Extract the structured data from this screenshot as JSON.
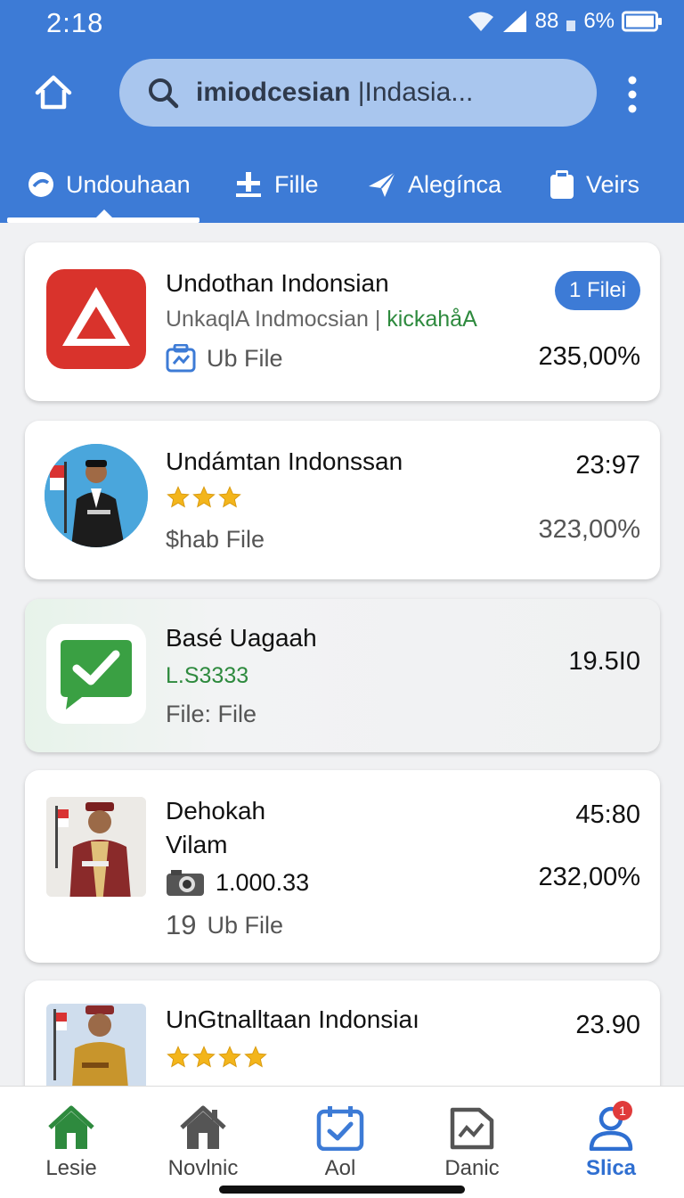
{
  "status_bar": {
    "time": "2:18",
    "network": "88",
    "battery": "6%"
  },
  "search": {
    "query_bold": "imiodcesian",
    "query_rest": " |Indasia..."
  },
  "tabs": [
    {
      "label": "Undouhaan",
      "icon": "download-icon",
      "active": true
    },
    {
      "label": "Fille",
      "icon": "file-icon"
    },
    {
      "label": "Alegínca",
      "icon": "send-icon"
    },
    {
      "label": "Veirs",
      "icon": "folder-icon"
    }
  ],
  "items": [
    {
      "title": "Undothan Indonsian",
      "subtitle_gray": "UnkaqlA Indmocsian |",
      "subtitle_green": " kickahåA",
      "meta_icon": "sync-icon",
      "meta": "Ub File",
      "badge": "1 Filei",
      "right": "235,00%"
    },
    {
      "title": "Undámtan Indonssan",
      "stars": 3,
      "meta": "$hab File",
      "right_top": "23:97",
      "right": "323,00%"
    },
    {
      "title": "Basé Uagaah",
      "subtitle_green": "L.S3333",
      "meta": "File: File",
      "right_top": "19.5I0"
    },
    {
      "title_line1": "Dehokah",
      "title_line2": "Vilam",
      "camera_value": "1.000.33",
      "meta_num": "19",
      "meta": "Ub File",
      "right_top": "45:80",
      "right": "232,00%"
    },
    {
      "title": "UnGtnalltaan Indonsiaı",
      "stars": 4,
      "right_top": "23.90"
    }
  ],
  "bottom_nav": [
    {
      "label": "Lesie",
      "icon": "home-icon",
      "color": "#2e8a3e"
    },
    {
      "label": "Novlnic",
      "icon": "house-icon",
      "color": "#444444"
    },
    {
      "label": "Aol",
      "icon": "calendar-check-icon",
      "color": "#444444"
    },
    {
      "label": "Danic",
      "icon": "document-icon",
      "color": "#444444"
    },
    {
      "label": "Slica",
      "icon": "profile-icon",
      "color": "#2f6fd1",
      "badge": "1"
    }
  ],
  "colors": {
    "header": "#3d7bd6",
    "accent_green": "#2e8a3e",
    "badge_blue": "#3d7bd6"
  }
}
